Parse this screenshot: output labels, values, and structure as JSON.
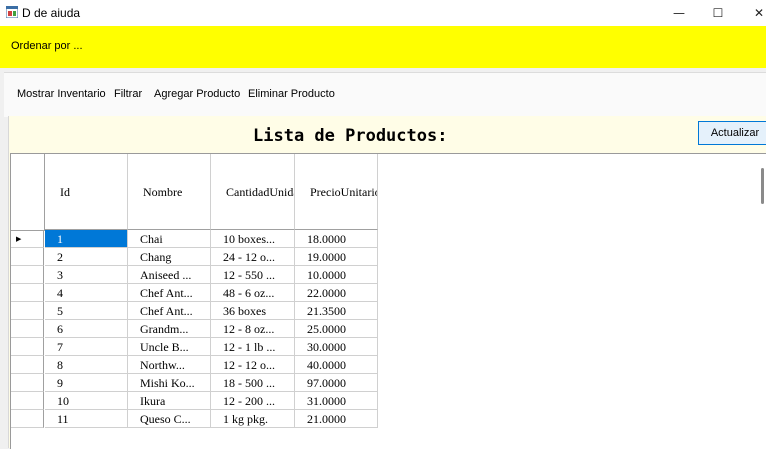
{
  "window": {
    "title": "D de aiuda",
    "controls": {
      "minimize": "—",
      "maximize": "☐",
      "close": "✕"
    },
    "icon": "app-form-icon"
  },
  "order_panel": {
    "label": "Ordenar por ...",
    "color": "#ffff00"
  },
  "menu": {
    "items": [
      "Mostrar Inventario",
      "Filtrar",
      "Agregar Producto",
      "Eliminar Producto"
    ]
  },
  "content": {
    "title": "Lista de Productos:",
    "refresh_label": "Actualizar",
    "background": "#fffde7"
  },
  "grid": {
    "columns": [
      "Id",
      "Nombre",
      "CantidadUnidad",
      "PrecioUnitario"
    ],
    "current_row_marker": "▶",
    "selected_cell_color": "#0078d7",
    "rows": [
      [
        "1",
        "Chai",
        "10 boxes...",
        "18.0000"
      ],
      [
        "2",
        "Chang",
        "24 - 12 o...",
        "19.0000"
      ],
      [
        "3",
        "Aniseed ...",
        "12 - 550 ...",
        "10.0000"
      ],
      [
        "4",
        "Chef Ant...",
        "48 - 6 oz...",
        "22.0000"
      ],
      [
        "5",
        "Chef Ant...",
        "36 boxes",
        "21.3500"
      ],
      [
        "6",
        "Grandm...",
        "12 - 8 oz...",
        "25.0000"
      ],
      [
        "7",
        "Uncle B...",
        "12 - 1 lb ...",
        "30.0000"
      ],
      [
        "8",
        "Northw...",
        "12 - 12 o...",
        "40.0000"
      ],
      [
        "9",
        "Mishi Ko...",
        "18 - 500 ...",
        "97.0000"
      ],
      [
        "10",
        "Ikura",
        "12 - 200 ...",
        "31.0000"
      ],
      [
        "11",
        "Queso C...",
        "1 kg pkg.",
        "21.0000"
      ]
    ]
  }
}
